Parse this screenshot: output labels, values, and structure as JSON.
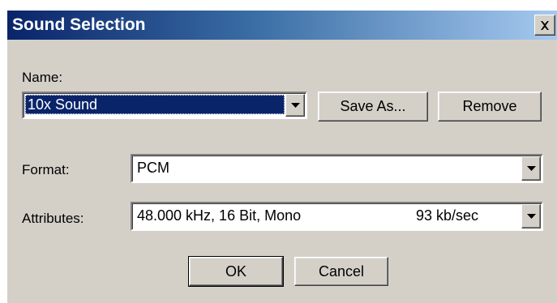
{
  "window": {
    "title": "Sound Selection",
    "close_icon": "close-icon"
  },
  "name": {
    "label": "Name:",
    "selected": "10x Sound",
    "dropdown_icon": "chevron-down-icon"
  },
  "buttons": {
    "save_as": "Save As...",
    "remove": "Remove",
    "ok": "OK",
    "cancel": "Cancel"
  },
  "format": {
    "label": "Format:",
    "value": "PCM"
  },
  "attributes": {
    "label": "Attributes:",
    "value": "48.000 kHz, 16 Bit, Mono",
    "rate": "93 kb/sec"
  },
  "colors": {
    "title_start": "#0a246a",
    "title_end": "#a6caf0",
    "face": "#d4d0c8",
    "selection": "#0a246a"
  }
}
